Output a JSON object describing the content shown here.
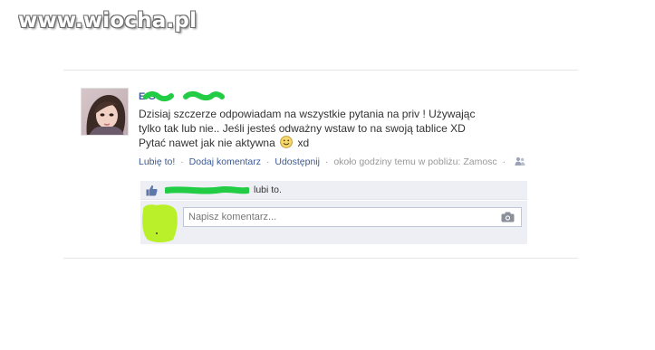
{
  "watermark": {
    "text": "www.wiocha.pl"
  },
  "post": {
    "author_name": "E     G",
    "text_lines": [
      "Dzisiaj szczerze odpowiadam na wszystkie pytania na priv ! Używając",
      "tylko tak lub nie.. Jeśli jesteś odważny wstaw to na swoją tablice XD"
    ],
    "last_line_before_emoji": "Pytać nawet jak nie aktywna",
    "last_line_after_emoji": "xd",
    "emoji_icon": "smiley-icon",
    "actions": {
      "like": "Lubię to!",
      "comment": "Dodaj komentarz",
      "share": "Udostępnij",
      "sep": "·",
      "meta": "około godziny temu w pobliżu: Zamosc",
      "audience_icon": "friends-icon"
    }
  },
  "likes": {
    "icon": "thumbs-up-icon",
    "suffix": "lubi to."
  },
  "comment": {
    "placeholder": "Napisz komentarz...",
    "camera_icon": "camera-icon"
  },
  "colors": {
    "link": "#3b5998",
    "scribble": "#22cc44",
    "panel": "#edeff4",
    "input_border": "#bdc7d8",
    "watermark_outline": "#6a6a6a"
  }
}
